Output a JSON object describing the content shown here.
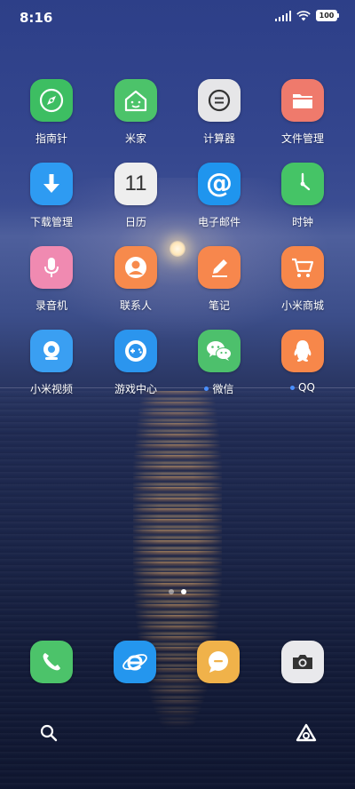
{
  "status_bar": {
    "time": "8:16",
    "battery": "100"
  },
  "apps": [
    {
      "label": "指南针",
      "icon": "compass-icon",
      "color": "#3dbe62"
    },
    {
      "label": "米家",
      "icon": "mi-home-icon",
      "color": "#4cc36a"
    },
    {
      "label": "计算器",
      "icon": "calculator-icon",
      "color": "#e6e6e8"
    },
    {
      "label": "文件管理",
      "icon": "folder-icon",
      "color": "#ef7a6c"
    },
    {
      "label": "下载管理",
      "icon": "download-icon",
      "color": "#2e9bf2"
    },
    {
      "label": "日历",
      "icon": "calendar-icon",
      "color": "#eeeeee",
      "day": "11"
    },
    {
      "label": "电子邮件",
      "icon": "email-icon",
      "color": "#1f95ee"
    },
    {
      "label": "时钟",
      "icon": "clock-icon",
      "color": "#45c466"
    },
    {
      "label": "录音机",
      "icon": "microphone-icon",
      "color": "#f08ab1"
    },
    {
      "label": "联系人",
      "icon": "contact-icon",
      "color": "#f78a4c"
    },
    {
      "label": "笔记",
      "icon": "pencil-icon",
      "color": "#f7874d"
    },
    {
      "label": "小米商城",
      "icon": "shopping-cart-icon",
      "color": "#f7874a"
    },
    {
      "label": "小米视频",
      "icon": "video-camera-icon",
      "color": "#3a9ff2"
    },
    {
      "label": "游戏中心",
      "icon": "game-controller-icon",
      "color": "#2b95ee"
    },
    {
      "label": "微信",
      "icon": "wechat-icon",
      "color": "#4dc06c",
      "new_dot": true
    },
    {
      "label": "QQ",
      "icon": "qq-penguin-icon",
      "color": "#f7874a",
      "new_dot": true
    }
  ],
  "dock": [
    {
      "name": "phone",
      "icon": "phone-icon",
      "color": "#4cc36a"
    },
    {
      "name": "browser",
      "icon": "browser-icon",
      "color": "#2496ee"
    },
    {
      "name": "messages",
      "icon": "message-icon",
      "color": "#f0b24a"
    },
    {
      "name": "camera",
      "icon": "camera-icon",
      "color": "#e9e9ec"
    }
  ],
  "page_indicator": {
    "pages": 2,
    "current": 2
  }
}
